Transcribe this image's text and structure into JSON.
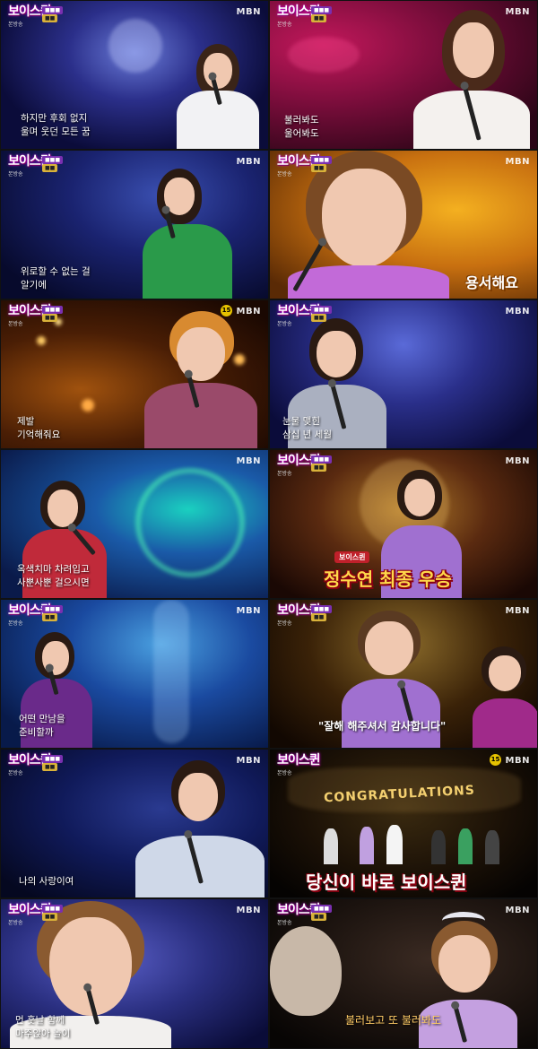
{
  "show": {
    "logo": "보이스퀸",
    "logo_sub": "본방송",
    "channel": "MBN",
    "age_rating": "15"
  },
  "panels": [
    {
      "subtitle": "하지만 후회 없지\n울며 웃던 모든 꿈"
    },
    {
      "subtitle": "불러봐도\n울어봐도"
    },
    {
      "subtitle": "위로할 수 없는 걸\n알기에"
    },
    {
      "subtitle": "용서해요"
    },
    {
      "subtitle": "제발\n기억해줘요"
    },
    {
      "subtitle": "눈물 맺힌\n삼십 년 세월"
    },
    {
      "subtitle": "옥색치마 차려입고\n사뿐사뿐 걸으시면"
    },
    {
      "caption_small": "보이스퀸",
      "caption_big": "정수연 최종 우승"
    },
    {
      "subtitle": "어떤 만남을\n준비할까"
    },
    {
      "subtitle": "\"잘해 해주셔서 감사합니다\""
    },
    {
      "subtitle": "나의 사랑이여"
    },
    {
      "banner": "CONGRATULATIONS",
      "caption_big": "당신이 바로 보이스퀸"
    },
    {
      "subtitle": "먼 훗날 함께\n마주앉아 놀이"
    },
    {
      "subtitle": "불러보고 또 불러봐도"
    }
  ]
}
